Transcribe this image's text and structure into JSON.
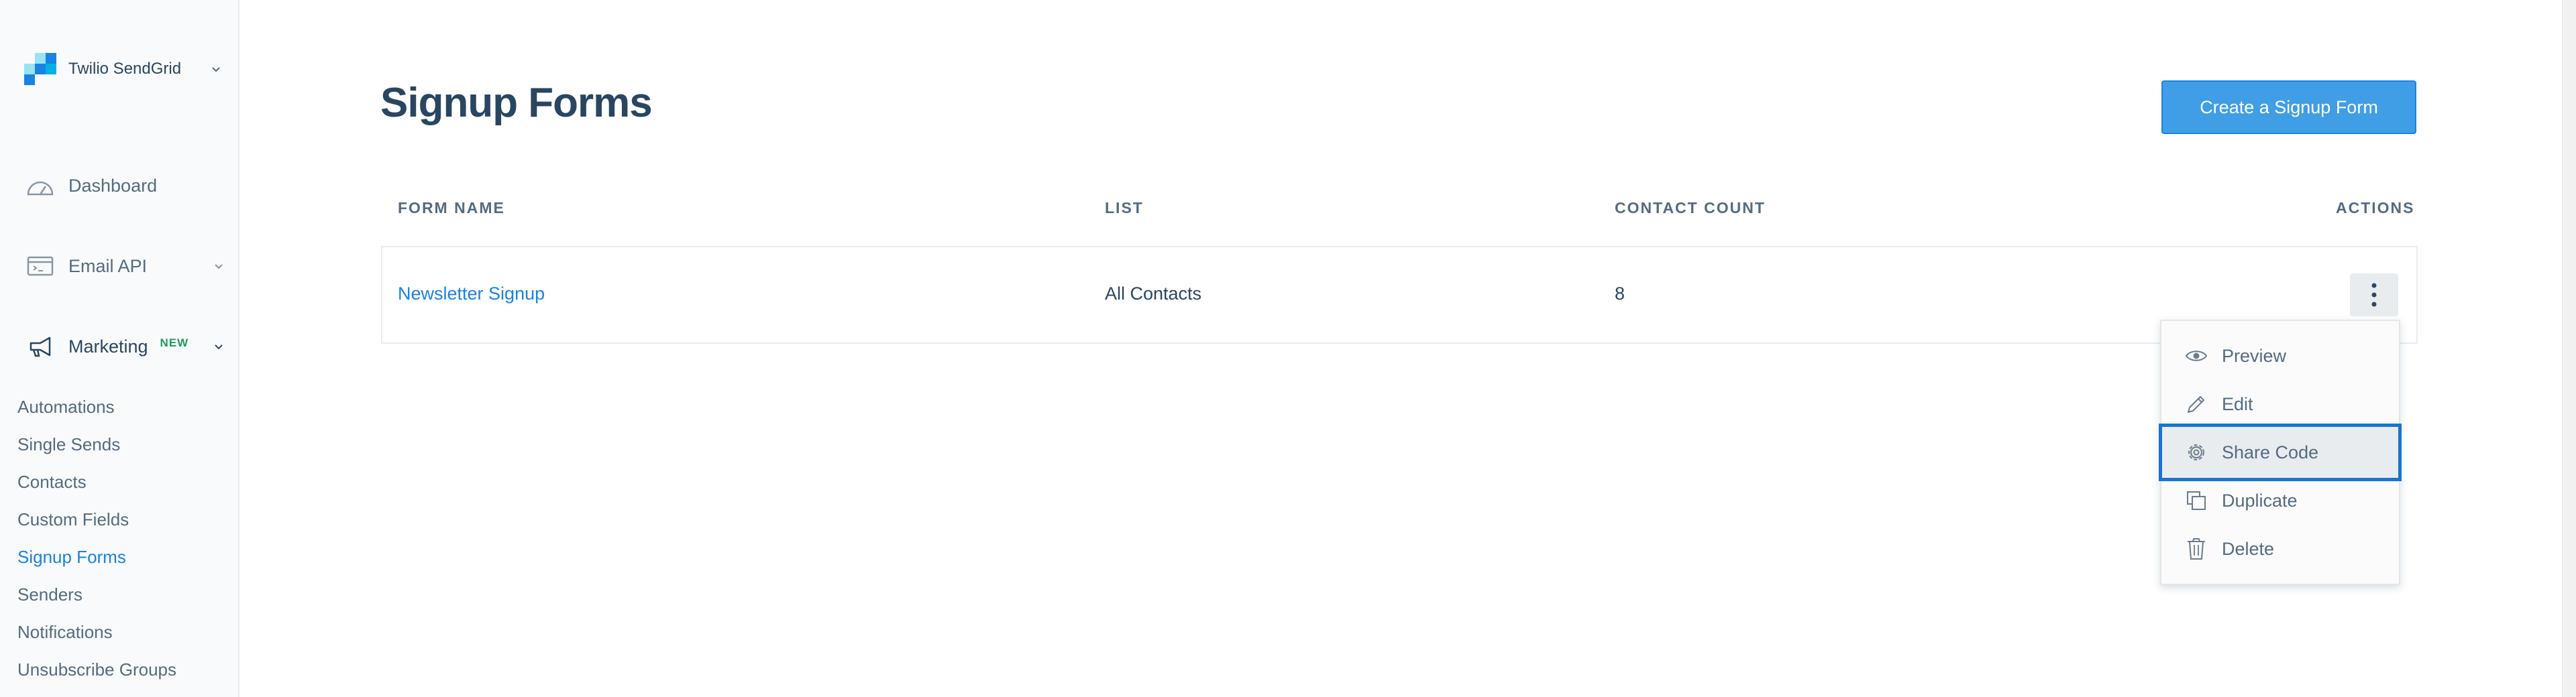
{
  "sidebar": {
    "brand": "Twilio SendGrid",
    "items": [
      {
        "label": "Dashboard"
      },
      {
        "label": "Email API"
      },
      {
        "label": "Marketing",
        "badge": "NEW"
      }
    ],
    "marketing_subitems": [
      "Automations",
      "Single Sends",
      "Contacts",
      "Custom Fields",
      "Signup Forms",
      "Senders",
      "Notifications",
      "Unsubscribe Groups"
    ]
  },
  "main": {
    "title": "Signup Forms",
    "create_button": "Create a Signup Form",
    "table": {
      "headers": [
        "FORM NAME",
        "LIST",
        "CONTACT COUNT",
        "ACTIONS"
      ],
      "rows": [
        {
          "form_name": "Newsletter Signup",
          "list": "All Contacts",
          "contact_count": "8"
        }
      ]
    },
    "actions_menu": [
      {
        "label": "Preview",
        "icon": "eye-icon"
      },
      {
        "label": "Edit",
        "icon": "pencil-icon"
      },
      {
        "label": "Share Code",
        "icon": "gear-icon"
      },
      {
        "label": "Duplicate",
        "icon": "copy-icon"
      },
      {
        "label": "Delete",
        "icon": "trash-icon"
      }
    ]
  },
  "colors": {
    "primary": "#1a82e2",
    "button": "#3f9ee6",
    "text": "#294661",
    "muted": "#546b81",
    "new_badge": "#1a9c5d"
  }
}
